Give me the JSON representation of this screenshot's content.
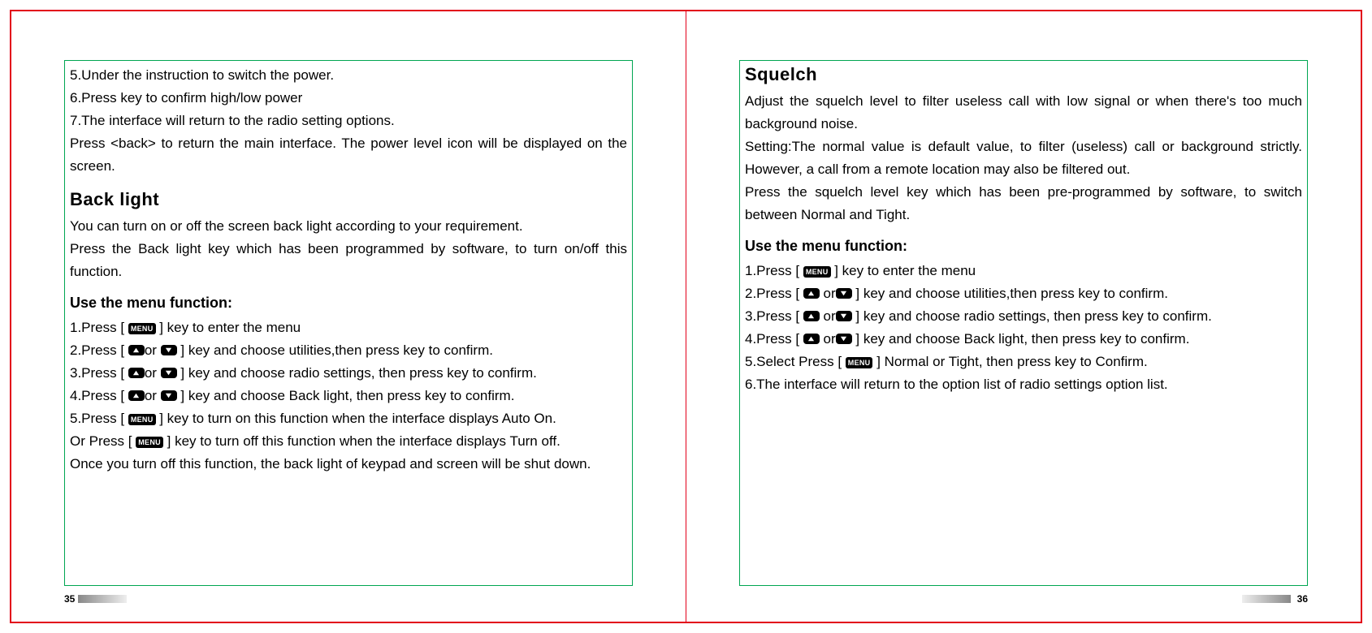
{
  "left": {
    "pageNumber": "35",
    "introLines": [
      "5.Under the instruction to switch the power.",
      "6.Press  key to confirm high/low power",
      "7.The interface will return to the radio setting options.",
      "Press <back> to return the main interface. The power level icon will be displayed on the screen."
    ],
    "section1Title": "Back light",
    "section1Body": [
      "You can turn on or off the screen back light according to your requirement.",
      "Press the Back light key which has been programmed by software, to turn on/off this function."
    ],
    "menuTitle": "Use the menu function:",
    "menuSteps": {
      "s1a": "1.Press [ ",
      "s1b": " ] key to enter the menu",
      "s2a": "2.Press [ ",
      "s2mid": "or",
      "s2b": " ] key and choose utilities,then press  key to confirm.",
      "s3a": "3.Press [ ",
      "s3mid": "or",
      "s3b": " ] key and choose radio settings, then press  key to confirm.",
      "s4a": "4.Press [ ",
      "s4mid": "or",
      "s4b": " ] key and choose Back light, then press  key to confirm.",
      "s5a": "5.Press [ ",
      "s5b": " ] key to turn on this function when the interface displays Auto On.",
      "s6a": "Or Press [ ",
      "s6b": " ] key to turn off this function when the interface displays Turn off.",
      "s7": "Once you turn off this function, the back light of keypad and screen will be shut down."
    }
  },
  "right": {
    "pageNumber": "36",
    "section1Title": "Squelch",
    "section1Body": [
      "Adjust the squelch level to filter useless call with low signal or when there's too much background noise.",
      "Setting:The normal value is default value, to filter (useless) call or background strictly. However, a call from a remote location may also be filtered out.",
      "Press the squelch level key which has been pre-programmed by software, to switch between Normal and Tight."
    ],
    "menuTitle": "Use the menu function:",
    "menuSteps": {
      "s1a": "1.Press [ ",
      "s1b": " ] key to enter the menu",
      "s2a": "2.Press [ ",
      "s2mid": "or",
      "s2b": " ] key and choose utilities,then press  key to confirm.",
      "s3a": "3.Press [ ",
      "s3mid": "or",
      "s3b": " ] key and choose radio settings, then press  key to confirm.",
      "s4a": "4.Press [ ",
      "s4mid": "or",
      "s4b": " ] key and choose Back light, then press  key to confirm.",
      "s5a": "5.Select Press [ ",
      "s5b": " ] Normal or Tight, then press  key to Confirm.",
      "s6": "6.The interface will return to the option list of radio settings option list."
    }
  },
  "keys": {
    "menuLabel": "MENU"
  }
}
